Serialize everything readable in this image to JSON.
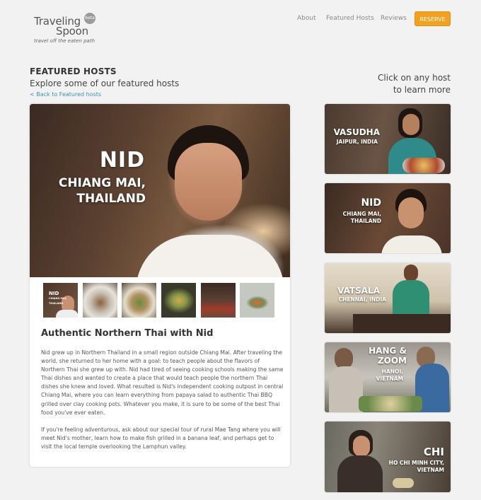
{
  "logo": {
    "word1": "Traveling",
    "word2": "Spoon",
    "badge": "beta",
    "tagline": "travel off the eaten path"
  },
  "nav": {
    "about": "About",
    "featured_hosts": "Featured Hosts",
    "reviews": "Reviews",
    "reserve": "RESERVE"
  },
  "colors": {
    "accent": "#f0a11f",
    "link": "#3a8fb7",
    "page_bg": "#f2f2f2"
  },
  "section": {
    "title": "FEATURED HOSTS",
    "subtitle": "Explore some of our featured hosts",
    "back_link": "< Back to Featured hosts"
  },
  "hint": {
    "line1": "Click on any host",
    "line2": "to learn more"
  },
  "feature": {
    "name": "NID",
    "location_line1": "CHIANG MAI,",
    "location_line2": "THAILAND",
    "thumb_label": "NID",
    "thumb_sublabel": "CHIANG MAI, THAILAND",
    "title": "Authentic Northern Thai with Nid",
    "paragraph1": "Nid grew up in Northern Thailand in a small region outside Chiang Mai. After traveling the world, she returned to her home with a goal: to teach people about the flavors of Northern Thai she grew up with. Nid had tired of seeing cooking schools making the same Thai dishes and wanted to create a place that would teach people the northern Thai dishes she knew and loved. What resulted is Nid's independent cooking outpost in central Chiang Mai, where you can learn everything from papaya salad to authentic Thai BBQ grilled over clay cooking pots. Whatever you make, it is sure to be some of the best Thai food you've ever eaten.",
    "paragraph2": "If you're feeling adventurous, ask about our special tour of rural Mae Tang where you will meet Nid's mother, learn how to make fish grilled in a banana leaf, and perhaps get to visit the local temple overlooking the Lamphun valley."
  },
  "hosts": [
    {
      "name": "VASUDHA",
      "location": "JAIPUR, INDIA"
    },
    {
      "name": "NID",
      "location_line1": "CHIANG MAI,",
      "location_line2": "THAILAND"
    },
    {
      "name": "VATSALA",
      "location": "CHENNAI, INDIA"
    },
    {
      "name_line1": "HANG &",
      "name_line2": "ZOOM",
      "location_line1": "HANOI,",
      "location_line2": "VIETNAM"
    },
    {
      "name": "CHI",
      "location_line1": "HO CHI MINH CITY,",
      "location_line2": "VIETNAM"
    }
  ]
}
